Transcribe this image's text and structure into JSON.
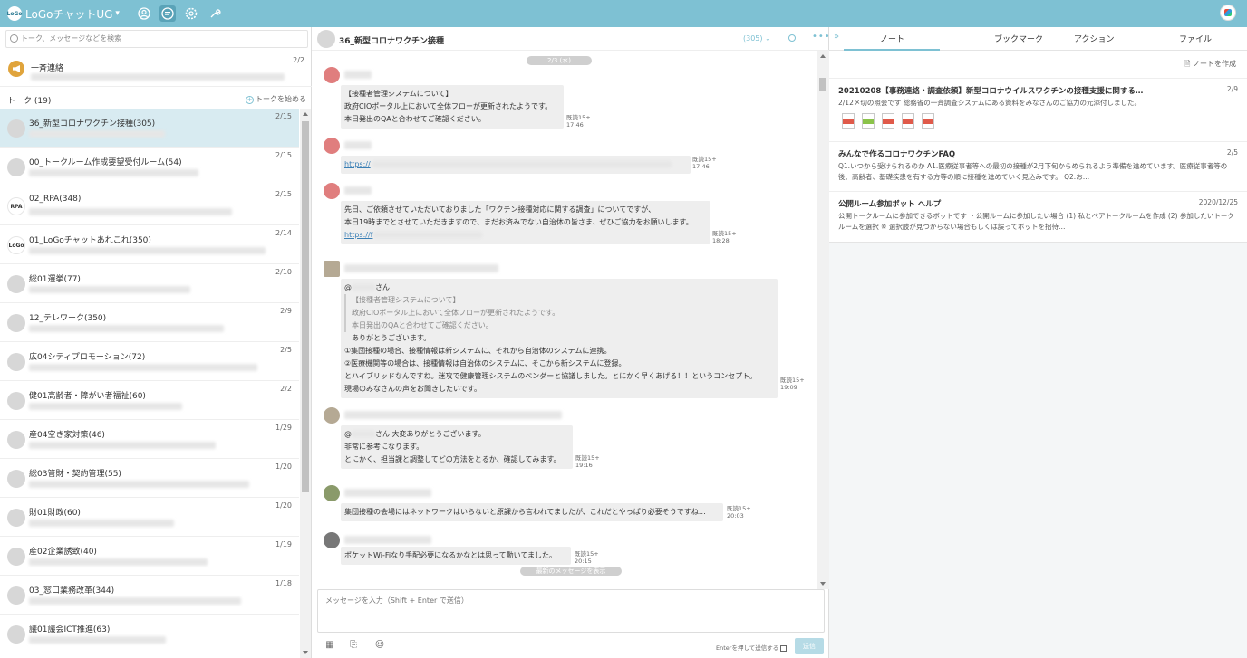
{
  "topbar": {
    "logo_text": "LoGo",
    "app_name": "LoGoチャットUG",
    "dropdown_arrow": "▾"
  },
  "left": {
    "search_placeholder": "トーク、メッセージなどを検索",
    "broadcast": {
      "title": "一斉連絡",
      "count": "2/2"
    },
    "talk_label": "トーク (19)",
    "new_talk": "トークを始める",
    "rooms": [
      {
        "name": "36_新型コロナワクチン接種(305)",
        "date": "2/15",
        "avatar": ""
      },
      {
        "name": "00_トークルーム作成要望受付ルーム(54)",
        "date": "2/15",
        "avatar": ""
      },
      {
        "name": "02_RPA(348)",
        "date": "2/15",
        "avatar": "RPA"
      },
      {
        "name": "01_LoGoチャットあれこれ(350)",
        "date": "2/14",
        "avatar": "LoGo"
      },
      {
        "name": "総01選挙(77)",
        "date": "2/10",
        "avatar": ""
      },
      {
        "name": "12_テレワーク(350)",
        "date": "2/9",
        "avatar": ""
      },
      {
        "name": "広04シティプロモーション(72)",
        "date": "2/5",
        "avatar": ""
      },
      {
        "name": "健01高齢者・障がい者福祉(60)",
        "date": "2/2",
        "avatar": ""
      },
      {
        "name": "産04空き家対策(46)",
        "date": "1/29",
        "avatar": ""
      },
      {
        "name": "総03管財・契約管理(55)",
        "date": "1/20",
        "avatar": ""
      },
      {
        "name": "財01財政(60)",
        "date": "1/20",
        "avatar": ""
      },
      {
        "name": "産02企業誘致(40)",
        "date": "1/19",
        "avatar": ""
      },
      {
        "name": "03_窓口業務改革(344)",
        "date": "1/18",
        "avatar": ""
      },
      {
        "name": "議01議会ICT推進(63)",
        "date": "",
        "avatar": ""
      }
    ]
  },
  "chat": {
    "title": "36_新型コロナワクチン接種",
    "count": "(305) ⌄",
    "more": "•••",
    "date_chip": "2/3 (水)",
    "messages": {
      "m1": {
        "line1": "【接種者管理システムについて】",
        "line2": "政府CIOポータル上において全体フローが更新されたようです。",
        "line3": "本日発出のQAと合わせてご確認ください。",
        "read": "既読15+",
        "time": "17:46"
      },
      "m2": {
        "link": "https://",
        "read": "既読15+",
        "time": "17:46"
      },
      "m3": {
        "line1": "先日、ご依頼させていただいておりました「ワクチン接種対応に関する調査」についてですが、",
        "line2": "本日19時までとさせていただきますので、まだお済みでない自治体の皆さま、ぜひご協力をお願いします。",
        "link": "https://f",
        "read": "既読15+",
        "time": "18:28"
      },
      "m4": {
        "mention": "@",
        "san": "さん",
        "q1": "【接種者管理システムについて】",
        "q2": "政府CIOポータル上において全体フローが更新されたようです。",
        "q3": "本日発出のQAと合わせてご確認ください。",
        "line1": "ありがとうございます。",
        "line2": "①集団接種の場合、接種情報は新システムに、それから自治体のシステムに連携。",
        "line3": "②医療機関等の場合は、接種情報は自治体のシステムに、そこから新システムに登録。",
        "line4": "とハイブリッドなんですね。迷攻で健康管理システムのベンダーと協議しました。とにかく早くあげる！！というコンセプト。",
        "line5": "現場のみなさんの声をお聞きしたいです。",
        "read": "既読15+",
        "time": "19:09"
      },
      "m5": {
        "mention": "@",
        "line1": "さん 大変ありがとうございます。",
        "line2": "非常に参考になります。",
        "line3": "とにかく、担当課と調整してどの方法をとるか、確認してみます。",
        "read": "既読15+",
        "time": "19:16"
      },
      "m6": {
        "line1": "集団接種の会場にはネットワークはいらないと原課から言われてましたが、これだとやっぱり必要そうですね…",
        "read": "既読15+",
        "time": "20:03"
      },
      "m7": {
        "line1": "ポケットWi-Fiなり手配必要になるかなとは思って動いてました。",
        "read": "既読15+",
        "time": "20:15"
      }
    },
    "latest_chip": "最新のメッセージを表示",
    "input_placeholder": "メッセージを入力（Shift + Enter で送信）",
    "enter_label": "Enterを押して送信する",
    "send_label": "送信"
  },
  "right": {
    "tabs": [
      "ノート",
      "ブックマーク",
      "アクション",
      "ファイル"
    ],
    "make_note": "ノートを作成",
    "notes": [
      {
        "title": "20210208【事務連絡・調査依頼】新型コロナウイルスワクチンの接種支援に関する…",
        "date": "2/9",
        "body": "2/12〆切の照会です 総務省の一斉調査システムにある資料をみなさんのご協力の元添付しました。"
      },
      {
        "title": "みんなで作るコロナワクチンFAQ",
        "date": "2/5",
        "body": "Q1.いつから受けられるのか A1.医療従事者等への最初の接種が2月下旬からめられるよう準備を進めています。医療従事者等の後、高齢者、基礎疾患を有する方等の順に接種を進めていく見込みです。 Q2.お…"
      },
      {
        "title": "公開ルーム参加ボット ヘルプ",
        "date": "2020/12/25",
        "body": "公開トークルームに参加できるボットです ・公開ルームに参加したい場合 (1) 私とペアトークルームを作成 (2) 参加したいトークルームを選択 ※ 選択肢が見つからない場合もしくは誤ってボットを招待…"
      }
    ]
  },
  "colors": {
    "accent": "#7ec1d3",
    "selected": "#d8ebf1"
  }
}
